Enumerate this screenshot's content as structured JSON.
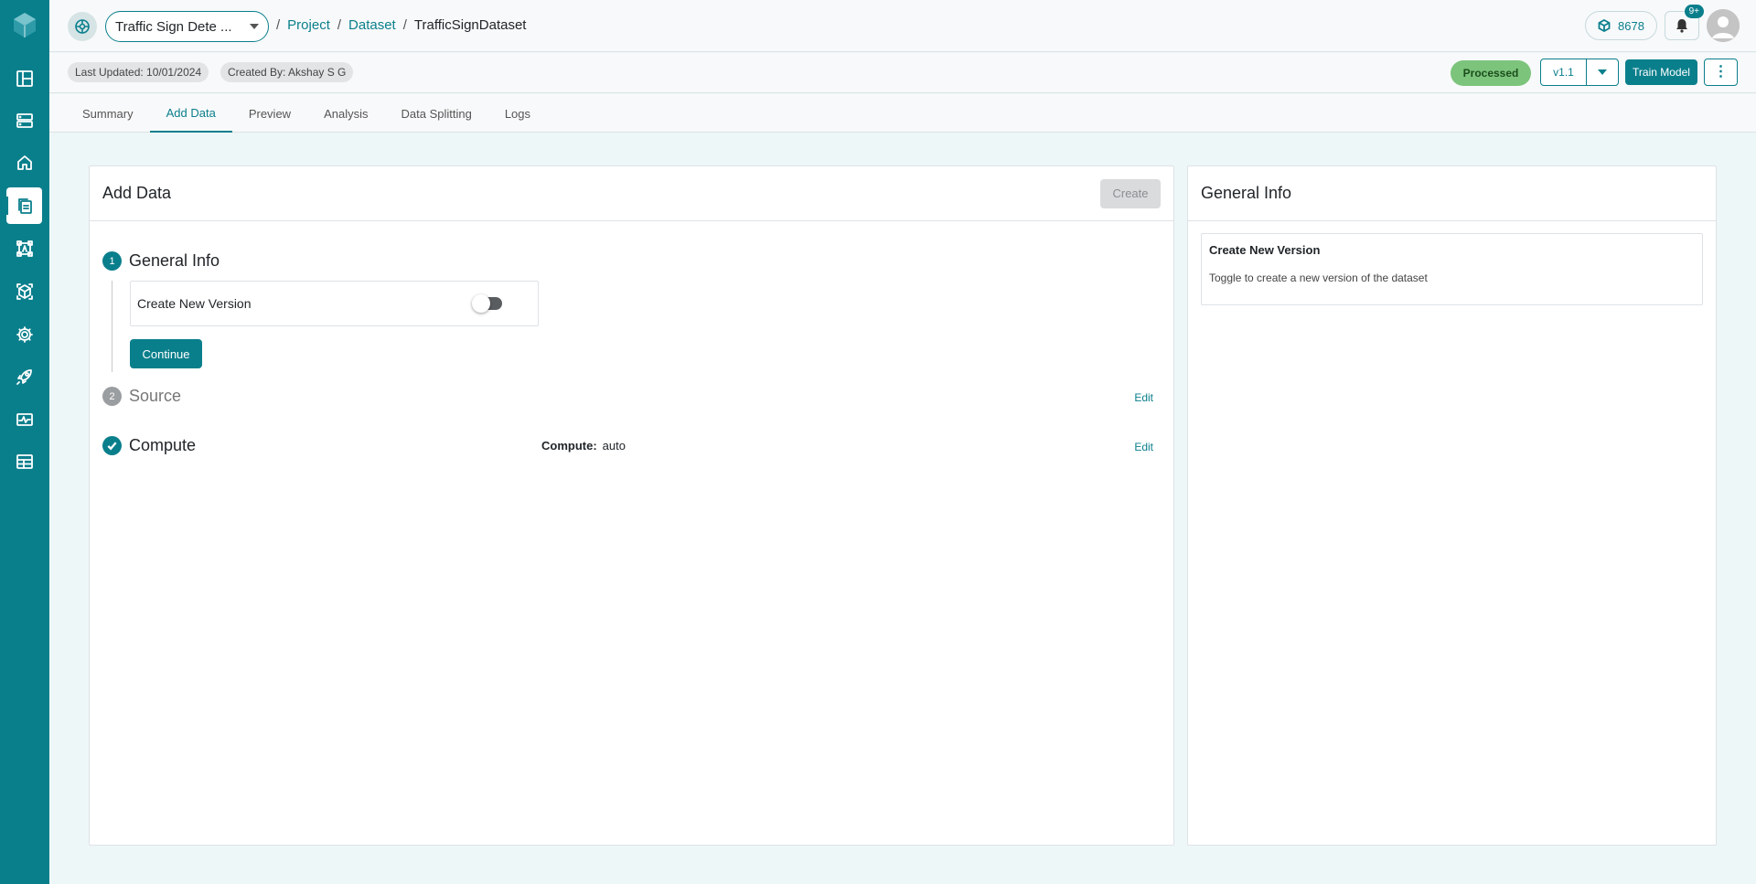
{
  "sidebar": {
    "items": [
      {
        "icon": "dashboard-icon"
      },
      {
        "icon": "storage-icon"
      },
      {
        "icon": "home-icon"
      },
      {
        "icon": "dataset-icon",
        "active": true
      },
      {
        "icon": "annotation-icon"
      },
      {
        "icon": "model-icon"
      },
      {
        "icon": "settings-gear-icon"
      },
      {
        "icon": "deploy-rocket-icon"
      },
      {
        "icon": "monitoring-icon"
      },
      {
        "icon": "table-icon"
      }
    ]
  },
  "header": {
    "project_name": "Traffic Sign Dete ...",
    "breadcrumb": {
      "project": "Project",
      "dataset": "Dataset",
      "current": "TrafficSignDataset"
    },
    "credits": "8678",
    "notifications_badge": "9+"
  },
  "subheader": {
    "last_updated": "Last Updated: 10/01/2024",
    "created_by": "Created By: Akshay S G",
    "status": "Processed",
    "version": "v1.1",
    "train_model": "Train Model",
    "colors": {
      "accent": "#0a7f8c",
      "status": "#7cc47c"
    }
  },
  "tabs": [
    {
      "label": "Summary"
    },
    {
      "label": "Add Data",
      "active": true
    },
    {
      "label": "Preview"
    },
    {
      "label": "Analysis"
    },
    {
      "label": "Data Splitting"
    },
    {
      "label": "Logs"
    }
  ],
  "main": {
    "title": "Add Data",
    "create_label": "Create",
    "steps": [
      {
        "num": "1",
        "title": "General Info",
        "state": "active"
      },
      {
        "num": "2",
        "title": "Source",
        "state": "inactive",
        "edit": "Edit"
      },
      {
        "num": "",
        "title": "Compute",
        "state": "done",
        "edit": "Edit"
      }
    ],
    "toggle_label": "Create New Version",
    "toggle_on": false,
    "continue_label": "Continue",
    "compute_label": "Compute:",
    "compute_value": "auto"
  },
  "side": {
    "title": "General Info",
    "box_title": "Create New Version",
    "box_desc": "Toggle to create a new version of the dataset"
  }
}
